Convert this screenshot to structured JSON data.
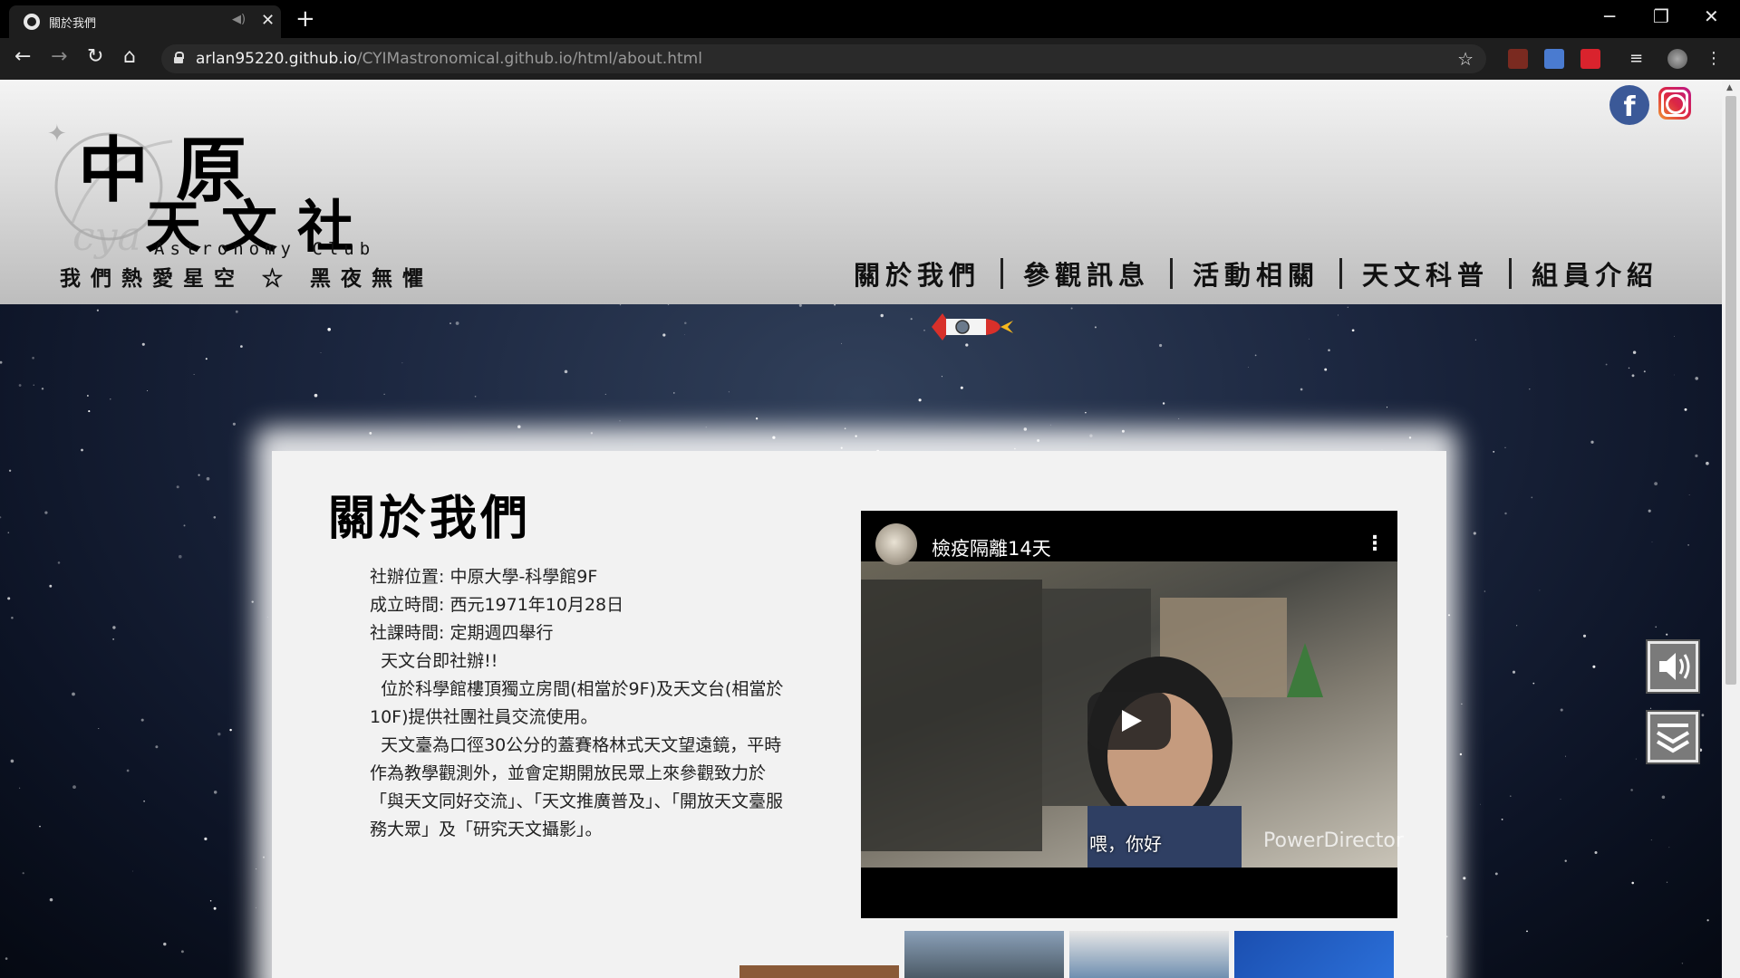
{
  "browser": {
    "tab_title": "關於我們",
    "url_host": "arlan95220.github.io",
    "url_path": "/CYIMastronomical.github.io/html/about.html"
  },
  "logo": {
    "zh_line1": "中原",
    "zh_line2": "天文社",
    "en": "Astronomy Club"
  },
  "slogan": "我們熱愛星空 ☆ 黑夜無懼",
  "nav": {
    "items": [
      {
        "label": "關於我們"
      },
      {
        "label": "參觀訊息"
      },
      {
        "label": "活動相關"
      },
      {
        "label": "天文科普"
      },
      {
        "label": "組員介紹"
      }
    ]
  },
  "social": {
    "fb_glyph": "f"
  },
  "about": {
    "title": "關於我們",
    "lines": [
      "社辦位置: 中原大學-科學館9F",
      "成立時間: 西元1971年10月28日",
      "社課時間: 定期週四舉行",
      "  天文台即社辦!!",
      "  位於科學館樓頂獨立房間(相當於9F)及天文台(相當於10F)提供社團社員交流使用。",
      "  天文臺為口徑30公分的蓋賽格林式天文望遠鏡，平時作為教學觀測外，並會定期開放民眾上來參觀致力於「與天文同好交流」、「天文推廣普及」、「開放天文臺服務大眾」及「研究天文攝影」。"
    ]
  },
  "video": {
    "title": "檢疫隔離14天",
    "caption": "喂，你好",
    "watermark": "PowerDirector"
  },
  "colors": {
    "header_top": "#f4f4f4",
    "header_bottom": "#bdbdbd",
    "sky": "#1c2740",
    "card": "#f2f2f2"
  }
}
